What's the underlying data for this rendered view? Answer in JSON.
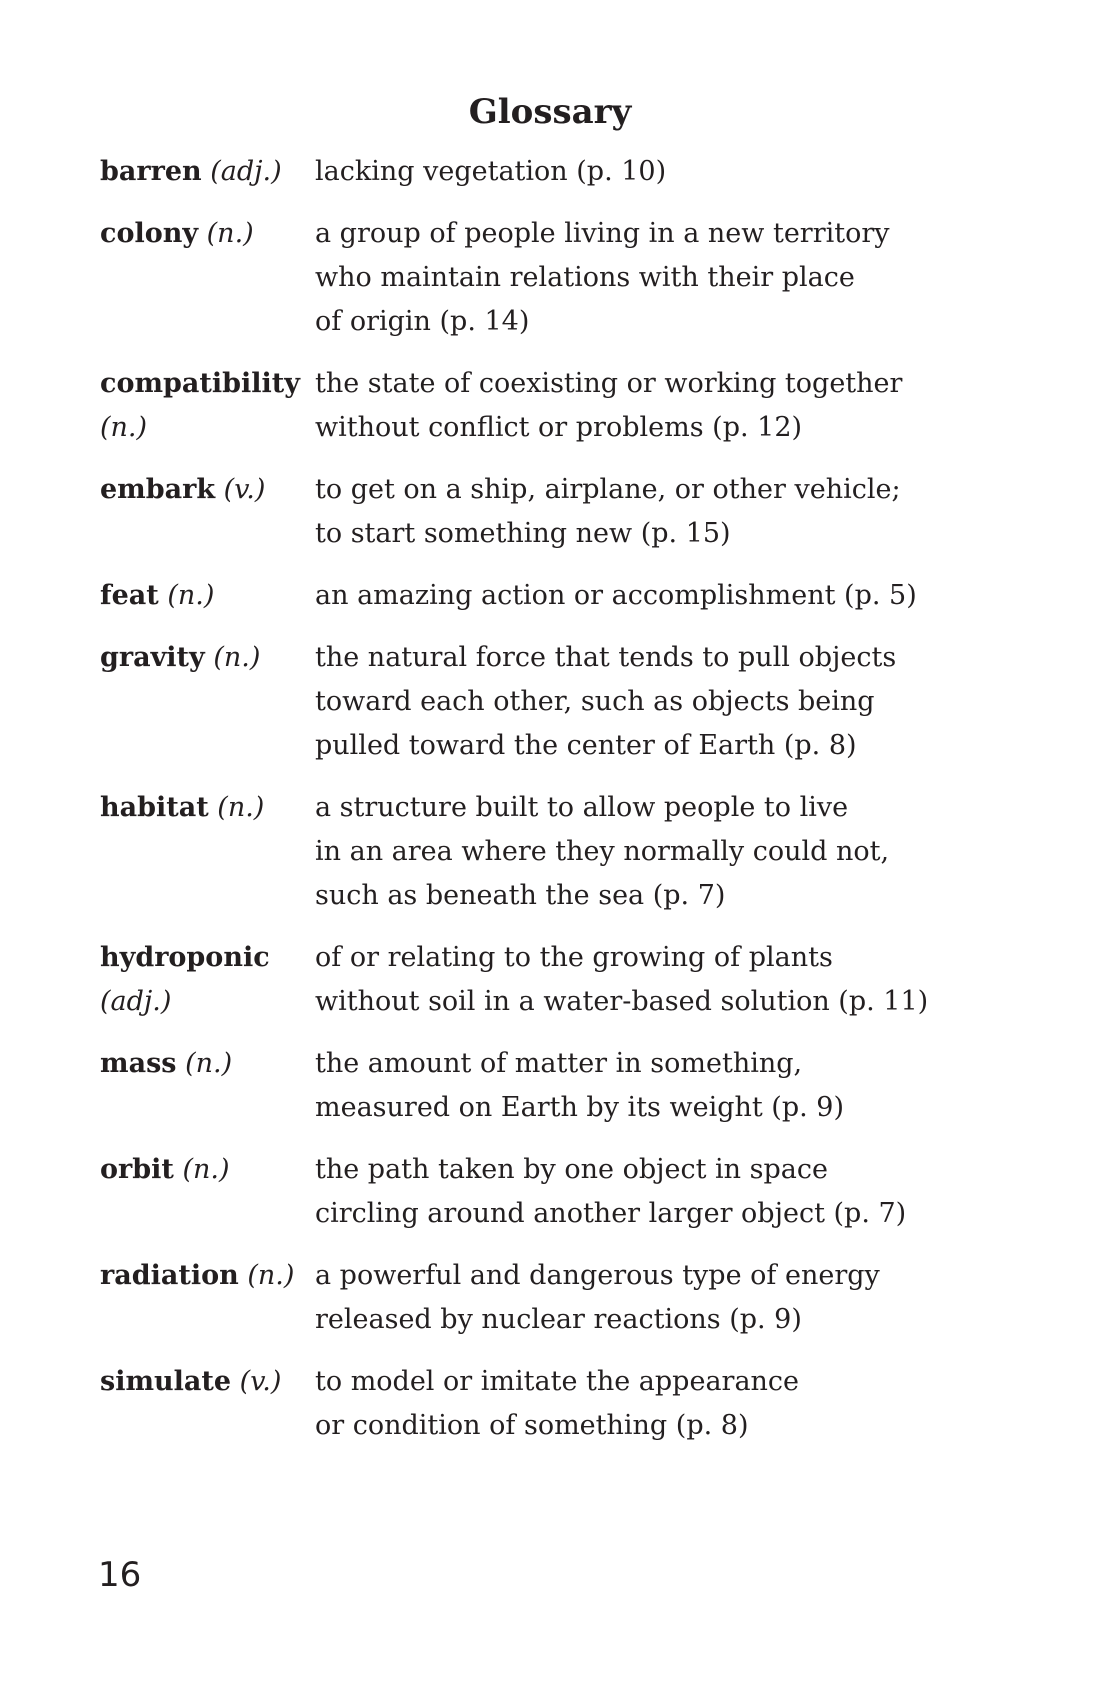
{
  "title": "Glossary",
  "page_number": "16",
  "entries": [
    {
      "term": "barren",
      "pos": "(adj.)",
      "pos_on_new_line": false,
      "definition_lines": [
        "lacking vegetation (p. 10)"
      ]
    },
    {
      "term": "colony",
      "pos": "(n.)",
      "pos_on_new_line": false,
      "definition_lines": [
        "a group of people living in a new territory",
        "who maintain relations with their place",
        "of origin (p. 14)"
      ]
    },
    {
      "term": "compatibility",
      "pos": "(n.)",
      "pos_on_new_line": true,
      "definition_lines": [
        "the state of coexisting or working together",
        "without conflict or problems (p. 12)"
      ]
    },
    {
      "term": "embark",
      "pos": "(v.)",
      "pos_on_new_line": false,
      "definition_lines": [
        "to get on a ship, airplane, or other vehicle;",
        "to start something new (p. 15)"
      ]
    },
    {
      "term": "feat",
      "pos": "(n.)",
      "pos_on_new_line": false,
      "definition_lines": [
        "an amazing action or accomplishment (p. 5)"
      ]
    },
    {
      "term": "gravity",
      "pos": "(n.)",
      "pos_on_new_line": false,
      "definition_lines": [
        "the natural force that tends to pull objects",
        "toward each other, such as objects being",
        "pulled toward the center of Earth (p. 8)"
      ]
    },
    {
      "term": "habitat",
      "pos": "(n.)",
      "pos_on_new_line": false,
      "definition_lines": [
        "a structure built to allow people to live",
        "in an area where they normally could not,",
        "such as beneath the sea (p. 7)"
      ]
    },
    {
      "term": "hydroponic",
      "pos": "(adj.)",
      "pos_on_new_line": true,
      "definition_lines": [
        "of or relating to the growing of plants",
        "without soil in a water-based solution (p. 11)"
      ]
    },
    {
      "term": "mass",
      "pos": "(n.)",
      "pos_on_new_line": false,
      "definition_lines": [
        "the amount of matter in something,",
        "measured on Earth by its weight (p. 9)"
      ]
    },
    {
      "term": "orbit",
      "pos": "(n.)",
      "pos_on_new_line": false,
      "definition_lines": [
        "the path taken by one object in space",
        "circling around another larger object (p. 7)"
      ]
    },
    {
      "term": "radiation",
      "pos": "(n.)",
      "pos_on_new_line": false,
      "definition_lines": [
        "a powerful and dangerous type of energy",
        "released by nuclear reactions (p. 9)"
      ]
    },
    {
      "term": "simulate",
      "pos": "(v.)",
      "pos_on_new_line": false,
      "definition_lines": [
        "to model or imitate the appearance",
        "or condition of something (p. 8)"
      ]
    }
  ]
}
